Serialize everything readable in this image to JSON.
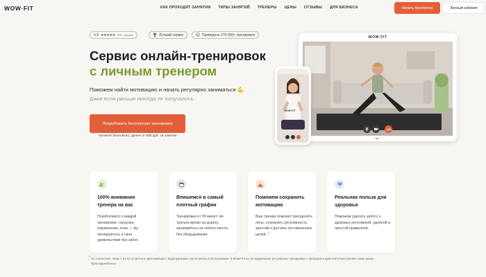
{
  "header": {
    "logo": "WOW·FIT",
    "nav": [
      "КАК ПРОХОДЯТ ЗАНЯТИЯ",
      "ТИПЫ ЗАНЯТИЙ",
      "ТРЕНЕРЫ",
      "ЦЕНЫ",
      "ОТЗЫВЫ",
      "ДЛЯ БИЗНЕСА"
    ],
    "start_button": "Начать бесплатно",
    "cabinet_button": "Личный кабинет"
  },
  "badges": {
    "rating_value": "4.9",
    "rating_stars": "★★★★★",
    "rating_count": "500+ отзывов",
    "best_service": "Лучший сервис",
    "trainings_done": "Проведено 270 000+ тренировок"
  },
  "hero": {
    "title_line1": "Сервис онлайн-тренировок",
    "title_line2": "с личным тренером",
    "subtitle": "Поможем найти мотивацию и начать регулярно заниматься 💪",
    "subtitle_muted": "Даже если раньше никогда не получалось",
    "cta_label": "Попробовать бесплатную тренировку",
    "cta_note": "Начните бесплатно, далее от 935 руб. за занятие"
  },
  "laptop": {
    "brand": "WOW·FIT"
  },
  "phone": {
    "shirt_text": "WOW·FIT"
  },
  "cards": [
    {
      "icon": "users-icon",
      "icon_bg": "#e7f1d4",
      "title": "100% внимания тренера на вас",
      "text": "Позаботимся о каждой тренировке: нагрузка, упражнения, план — вы тренируетесь в свое удовольствие без забот."
    },
    {
      "icon": "calendar-icon",
      "icon_bg": "#e4e4ea",
      "title": "Впишемся в самый плотный график",
      "text": "Тренировки от 30 минут. Не тратьте время на дорогу, занимайтесь из любого места, без оборудования."
    },
    {
      "icon": "mountain-icon",
      "icon_bg": "#fbe5dc",
      "title": "Поможем сохранить мотивацию",
      "text": "Ваш тренер поможет преодолеть лень, сохранить регулярность занятий и достичь поставленных целей. *"
    },
    {
      "icon": "heart-icon",
      "icon_bg": "#e3ecf5",
      "title": "Реальная польза для здоровья",
      "text": "Поможем сделать заботу о здоровье регулярной, удобной и простой привычкой."
    }
  ],
  "footnote": "По статистике, лишь 1 из 10 остается в приложениях с видеоуроками спустя месяц использования. В WowFit 9 из 10 продолжают регулярные тренировки с тренером и действительно меняют свою жизнь. Присоединяйтесь!",
  "colors": {
    "accent": "#e35f3a",
    "green": "#7a9a2e",
    "background": "#f7f6f3"
  }
}
